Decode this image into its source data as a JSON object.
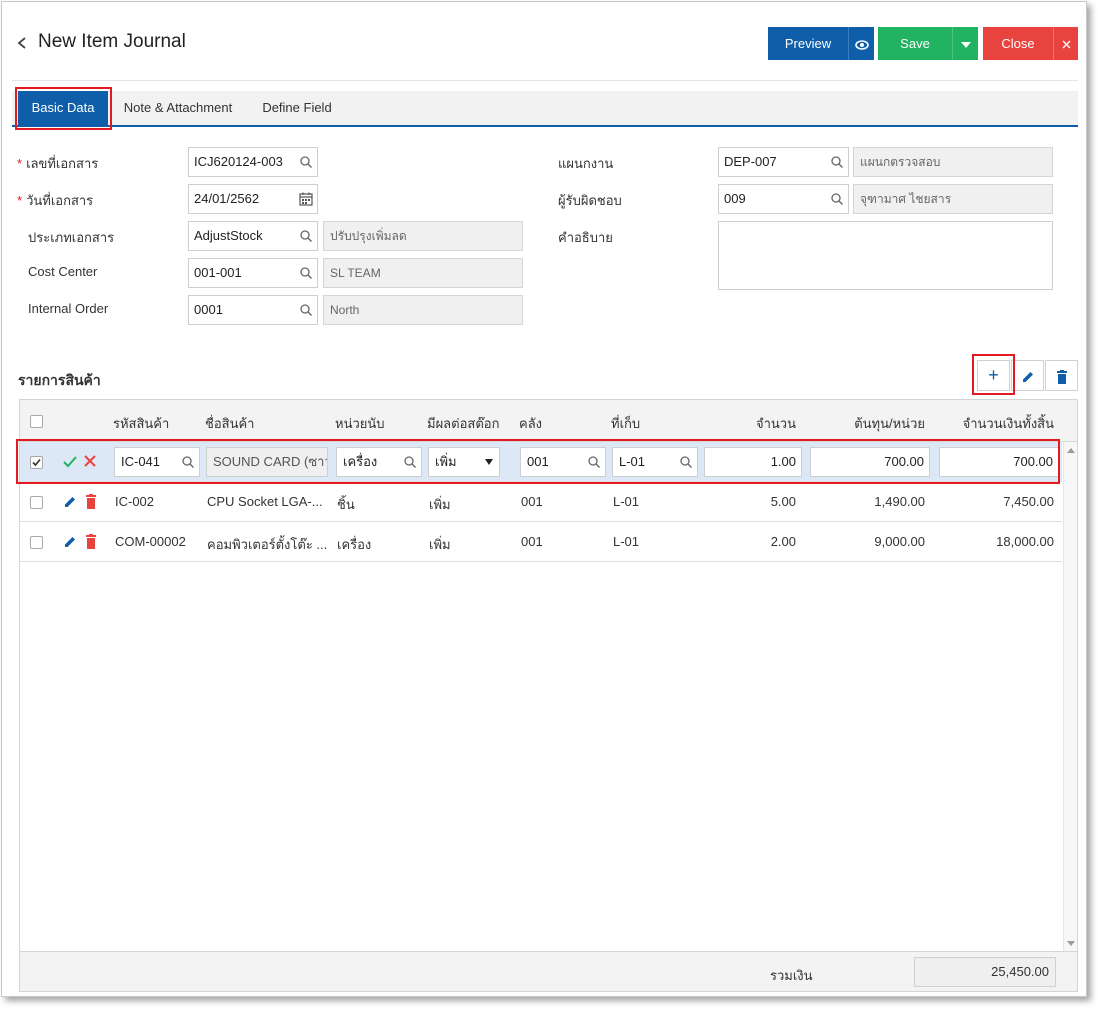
{
  "header": {
    "title": "New Item Journal",
    "preview_label": "Preview",
    "save_label": "Save",
    "close_label": "Close"
  },
  "tabs": [
    {
      "label": "Basic Data"
    },
    {
      "label": "Note & Attachment"
    },
    {
      "label": "Define Field"
    }
  ],
  "form": {
    "doc_no_label": "เลขที่เอกสาร",
    "doc_no": "ICJ620124-003",
    "doc_date_label": "วันที่เอกสาร",
    "doc_date": "24/01/2562",
    "doc_type_label": "ประเภทเอกสาร",
    "doc_type": "AdjustStock",
    "doc_type_desc": "ปรับปรุงเพิ่มลด",
    "cost_center_label": "Cost Center",
    "cost_center": "001-001",
    "cost_center_desc": "SL TEAM",
    "internal_order_label": "Internal Order",
    "internal_order": "0001",
    "internal_order_desc": "North",
    "department_label": "แผนกงาน",
    "department": "DEP-007",
    "department_desc": "แผนกตรวจสอบ",
    "responsible_label": "ผู้รับผิดชอบ",
    "responsible": "009",
    "responsible_desc": "จุฑามาศ ไชยสาร",
    "description_label": "คำอธิบาย",
    "description": ""
  },
  "items_section": {
    "title": "รายการสินค้า",
    "columns": {
      "code": "รหัสสินค้า",
      "name": "ชื่อสินค้า",
      "unit": "หน่วยนับ",
      "stock_effect": "มีผลต่อสต๊อก",
      "warehouse": "คลัง",
      "location": "ที่เก็บ",
      "qty": "จำนวน",
      "unit_cost": "ต้นทุน/หน่วย",
      "amount": "จำนวนเงินทั้งสิ้น"
    },
    "edit_row": {
      "code": "IC-041",
      "name": "SOUND CARD (ซาว",
      "unit": "เครื่อง",
      "stock_effect": "เพิ่ม",
      "warehouse": "001",
      "location": "L-01",
      "qty": "1.00",
      "unit_cost": "700.00",
      "amount": "700.00"
    },
    "rows": [
      {
        "code": "IC-002",
        "name": "CPU Socket LGA-...",
        "unit": "ชิ้น",
        "stock_effect": "เพิ่ม",
        "warehouse": "001",
        "location": "L-01",
        "qty": "5.00",
        "unit_cost": "1,490.00",
        "amount": "7,450.00"
      },
      {
        "code": "COM-00002",
        "name": "คอมพิวเตอร์ตั้งโต๊ะ ...",
        "unit": "เครื่อง",
        "stock_effect": "เพิ่ม",
        "warehouse": "001",
        "location": "L-01",
        "qty": "2.00",
        "unit_cost": "9,000.00",
        "amount": "18,000.00"
      }
    ],
    "total_label": "รวมเงิน",
    "total": "25,450.00"
  },
  "colors": {
    "primary": "#0e5eaa",
    "success": "#21b262",
    "danger": "#e9433f",
    "highlight": "#e21b23"
  }
}
